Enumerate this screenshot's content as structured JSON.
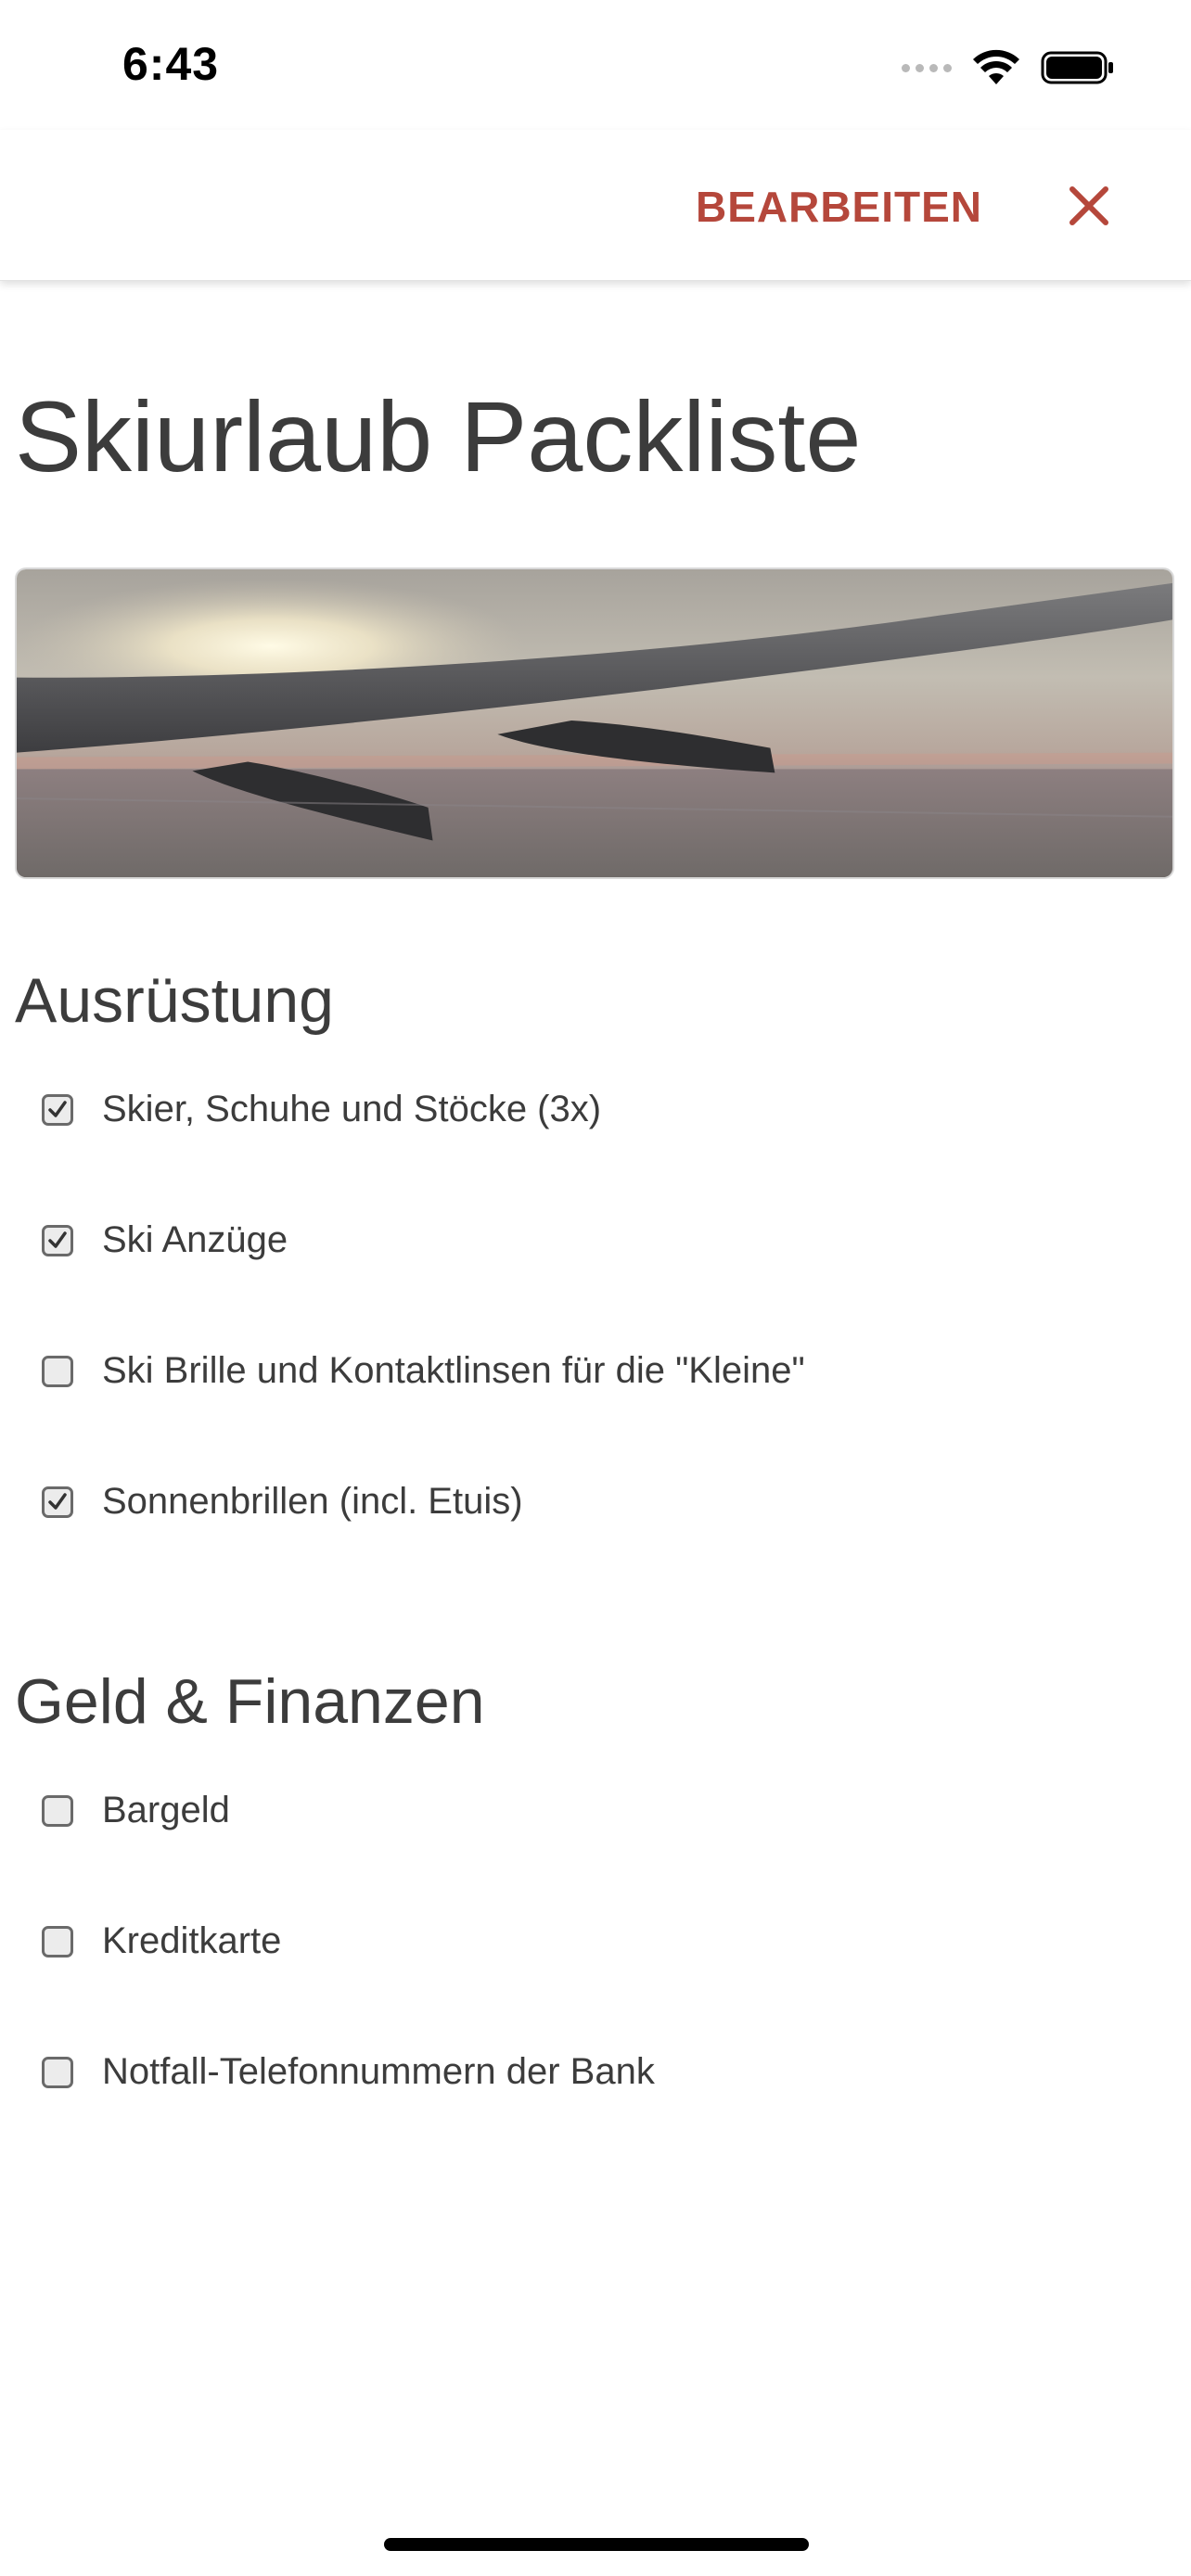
{
  "status_bar": {
    "time": "6:43"
  },
  "header": {
    "edit_label": "BEARBEITEN",
    "close_icon": "close-icon",
    "accent_color": "#b5473b"
  },
  "page": {
    "title": "Skiurlaub Packliste",
    "hero_image": "airplane-wing-sunset-photo"
  },
  "sections": [
    {
      "title": "Ausrüstung",
      "items": [
        {
          "label": "Skier, Schuhe und Stöcke (3x)",
          "checked": true
        },
        {
          "label": "Ski Anzüge",
          "checked": true
        },
        {
          "label": "Ski Brille und Kontaktlinsen für die \"Kleine\"",
          "checked": false
        },
        {
          "label": "Sonnenbrillen (incl. Etuis)",
          "checked": true
        }
      ]
    },
    {
      "title": "Geld & Finanzen",
      "items": [
        {
          "label": "Bargeld",
          "checked": false
        },
        {
          "label": "Kreditkarte",
          "checked": false
        },
        {
          "label": "Notfall-Telefonnummern der Bank",
          "checked": false
        }
      ]
    }
  ]
}
